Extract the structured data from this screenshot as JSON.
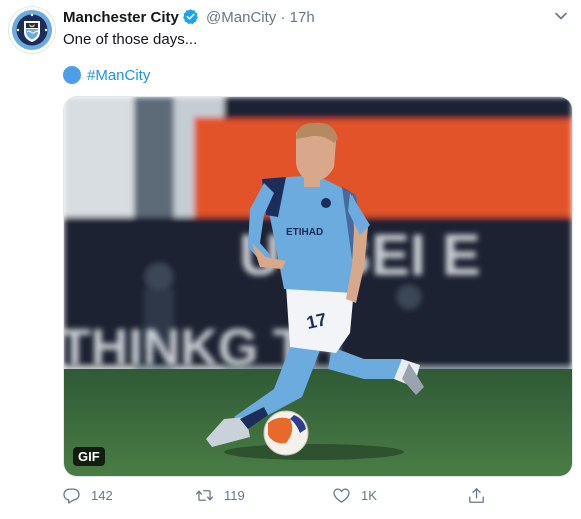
{
  "tweet": {
    "author": {
      "name": "Manchester City",
      "handle": "@ManCity",
      "verified": true
    },
    "separator": "·",
    "time": "17h",
    "text": "One of those days...",
    "hashtag": "#ManCity",
    "media": {
      "badge": "GIF",
      "player_number": "17",
      "background_text_top": "UMBEI E",
      "background_text_bottom": "THINKG TH",
      "sponsor_text": "ETIHAD"
    },
    "actions": {
      "reply_count": "142",
      "retweet_count": "119",
      "like_count": "1K"
    }
  },
  "colors": {
    "link": "#1b95e0",
    "secondary_text": "#657786",
    "city_blue": "#6cabdd",
    "pitch_green": "#3b6b3e"
  },
  "icons": [
    "manchester-city-crest",
    "verified-badge-icon",
    "more-chevron-icon",
    "hashtag-emoji-icon",
    "reply-icon",
    "retweet-icon",
    "like-icon",
    "share-icon"
  ]
}
